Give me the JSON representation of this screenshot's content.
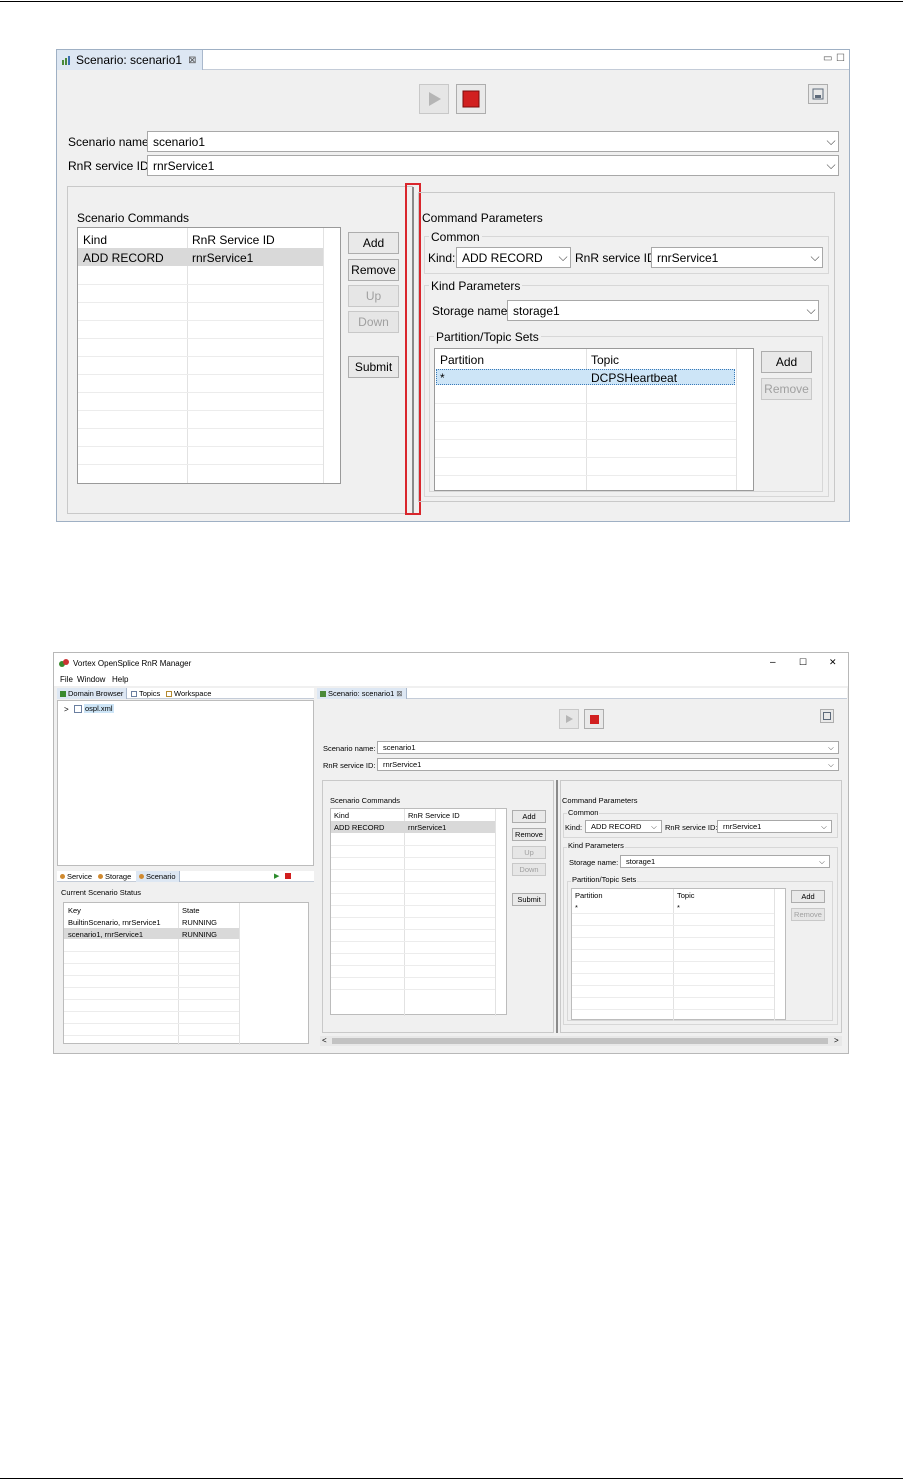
{
  "screenshot1": {
    "editor_tab": {
      "title": "Scenario: scenario1",
      "close_glyph": "⊠"
    },
    "view_min_glyph": "▭",
    "view_max_glyph": "☐",
    "toolbar": {
      "play_icon": "play-icon",
      "stop_icon": "stop-icon",
      "save_icon": "save-icon"
    },
    "scenario_name": {
      "label": "Scenario name:",
      "value": "scenario1"
    },
    "service_id": {
      "label": "RnR service ID:",
      "value": "rnrService1"
    },
    "commands": {
      "title": "Scenario Commands",
      "columns": [
        "Kind",
        "RnR Service ID"
      ],
      "rows": [
        {
          "kind": "ADD RECORD",
          "service": "rnrService1"
        }
      ],
      "buttons": {
        "add": "Add",
        "remove": "Remove",
        "up": "Up",
        "down": "Down",
        "submit": "Submit"
      }
    },
    "parameters": {
      "title": "Command Parameters",
      "common": {
        "title": "Common",
        "kind_label": "Kind:",
        "kind_value": "ADD RECORD",
        "service_label": "RnR service ID:",
        "service_value": "rnrService1"
      },
      "kind_params": {
        "title": "Kind Parameters",
        "storage_label": "Storage name:",
        "storage_value": "storage1"
      },
      "sets": {
        "title": "Partition/Topic Sets",
        "columns": [
          "Partition",
          "Topic"
        ],
        "rows": [
          {
            "partition": "*",
            "topic": "DCPSHeartbeat"
          }
        ],
        "buttons": {
          "add": "Add",
          "remove": "Remove"
        }
      }
    },
    "highlight_color": "#d9262c"
  },
  "screenshot2": {
    "window_title": "Vortex OpenSplice RnR Manager",
    "window_controls": {
      "minimize": "–",
      "maximize": "☐",
      "close": "✕"
    },
    "menu": [
      "File",
      "Window",
      "Help"
    ],
    "left_top_tabs": [
      "Domain Browser",
      "Topics",
      "Workspace"
    ],
    "tree": {
      "expand": ">",
      "item": "ospl.xml"
    },
    "left_bottom_tabs": [
      "Service",
      "Storage",
      "Scenario"
    ],
    "status": {
      "title": "Current Scenario Status",
      "columns": [
        "Key",
        "State"
      ],
      "rows": [
        {
          "key": "BuiltinScenario, rnrService1",
          "state": "RUNNING"
        },
        {
          "key": "scenario1, rnrService1",
          "state": "RUNNING"
        }
      ]
    },
    "editor_tab": {
      "title": "Scenario: scenario1",
      "close_glyph": "⊠"
    },
    "scenario_name": {
      "label": "Scenario name:",
      "value": "scenario1"
    },
    "service_id": {
      "label": "RnR service ID:",
      "value": "rnrService1"
    },
    "commands": {
      "title": "Scenario Commands",
      "columns": [
        "Kind",
        "RnR Service ID"
      ],
      "rows": [
        {
          "kind": "ADD RECORD",
          "service": "rnrService1"
        }
      ],
      "buttons": {
        "add": "Add",
        "remove": "Remove",
        "up": "Up",
        "down": "Down",
        "submit": "Submit"
      }
    },
    "parameters": {
      "title": "Command Parameters",
      "common": {
        "title": "Common",
        "kind_label": "Kind:",
        "kind_value": "ADD RECORD",
        "service_label": "RnR service ID:",
        "service_value": "rnrService1"
      },
      "kind_params": {
        "title": "Kind Parameters",
        "storage_label": "Storage name:",
        "storage_value": "storage1"
      },
      "sets": {
        "title": "Partition/Topic Sets",
        "columns": [
          "Partition",
          "Topic"
        ],
        "rows": [
          {
            "partition": "*",
            "topic": "*"
          }
        ],
        "buttons": {
          "add": "Add",
          "remove": "Remove"
        }
      }
    },
    "scroll": {
      "left": "<",
      "right": ">"
    }
  }
}
